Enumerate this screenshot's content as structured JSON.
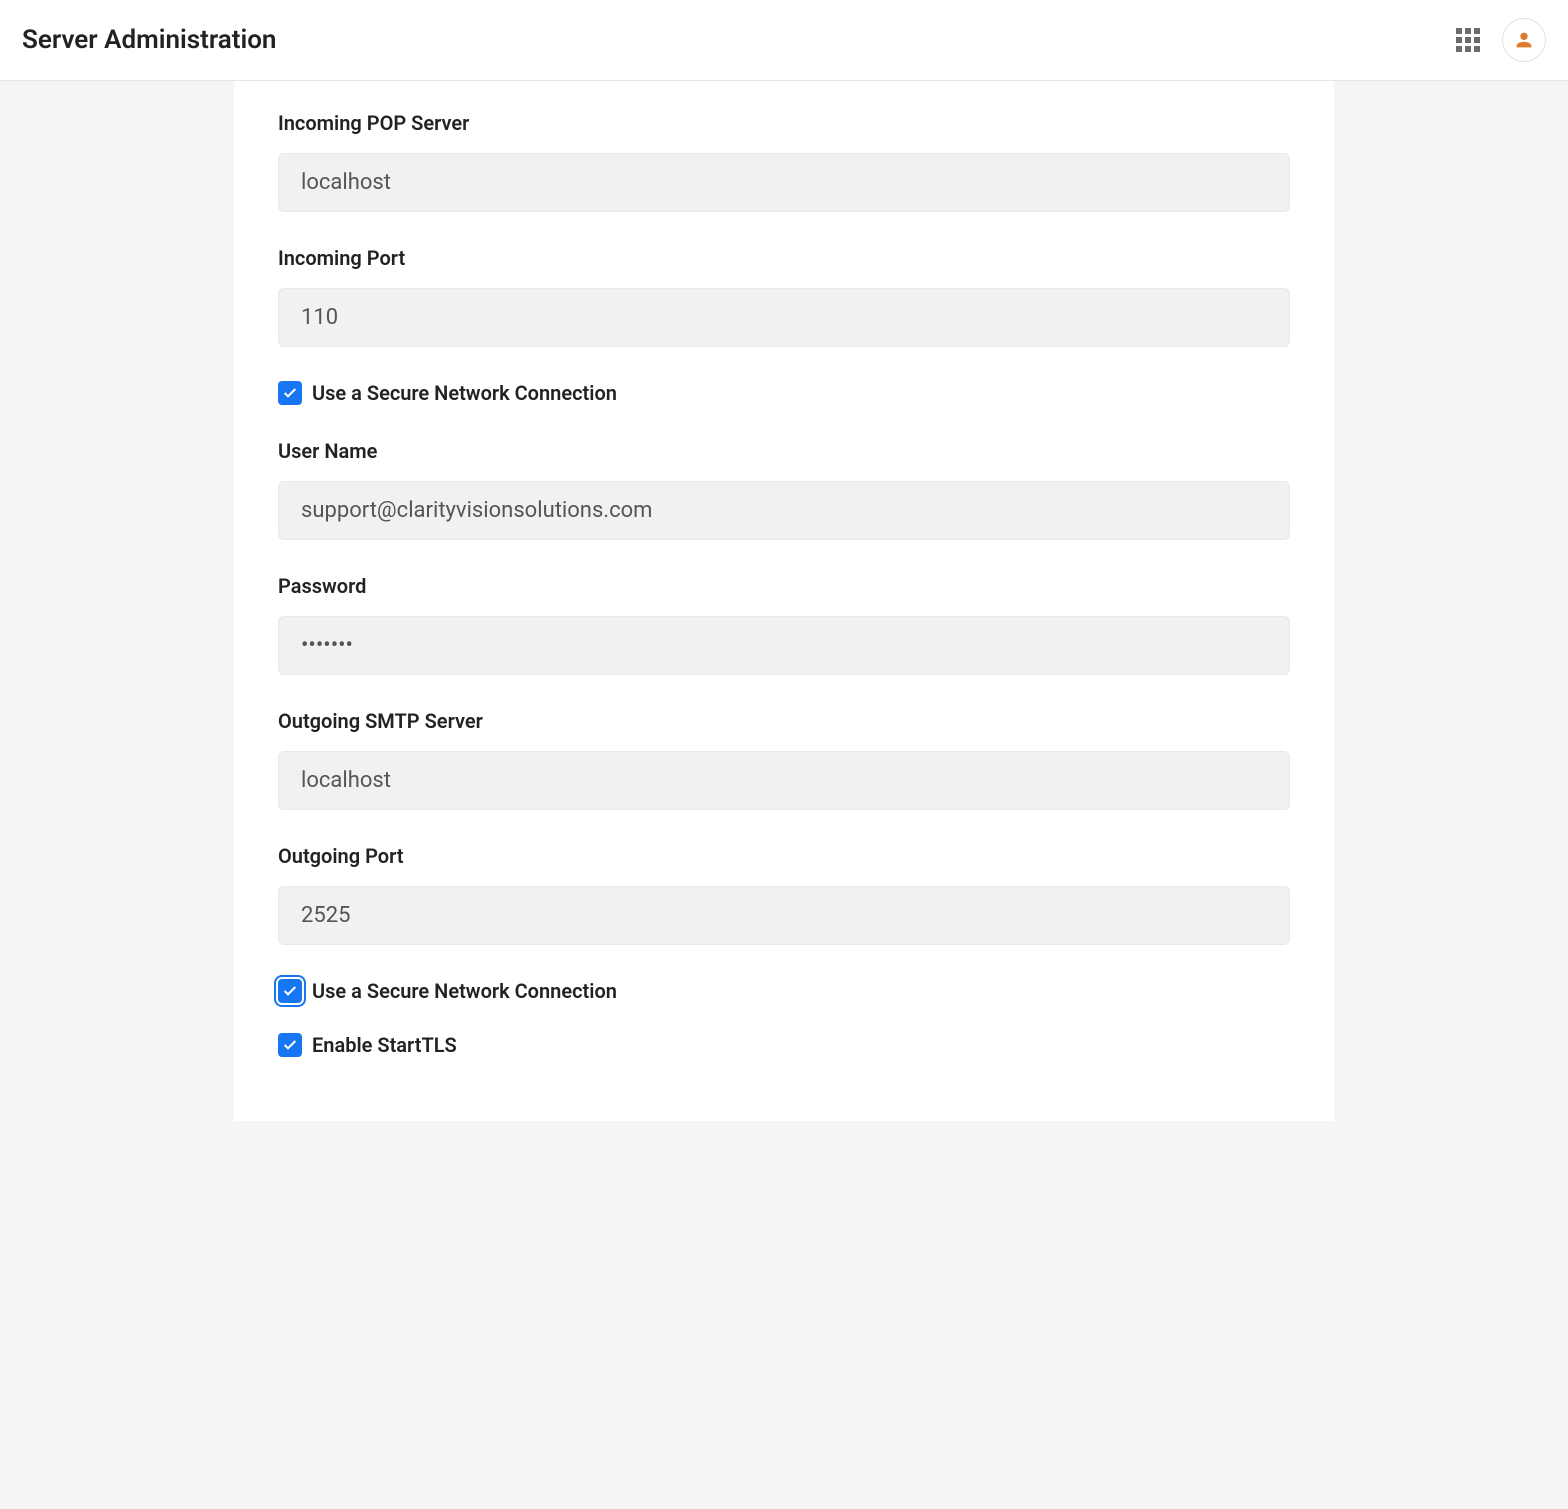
{
  "header": {
    "title": "Server Administration"
  },
  "form": {
    "incoming_pop_server": {
      "label": "Incoming POP Server",
      "value": "localhost"
    },
    "incoming_port": {
      "label": "Incoming Port",
      "value": "110"
    },
    "incoming_secure": {
      "label": "Use a Secure Network Connection",
      "checked": true
    },
    "username": {
      "label": "User Name",
      "value": "support@clarityvisionsolutions.com"
    },
    "password": {
      "label": "Password",
      "value": "•••••••"
    },
    "outgoing_smtp_server": {
      "label": "Outgoing SMTP Server",
      "value": "localhost"
    },
    "outgoing_port": {
      "label": "Outgoing Port",
      "value": "2525"
    },
    "outgoing_secure": {
      "label": "Use a Secure Network Connection",
      "checked": true,
      "focused": true
    },
    "enable_starttls": {
      "label": "Enable StartTLS",
      "checked": true
    }
  }
}
